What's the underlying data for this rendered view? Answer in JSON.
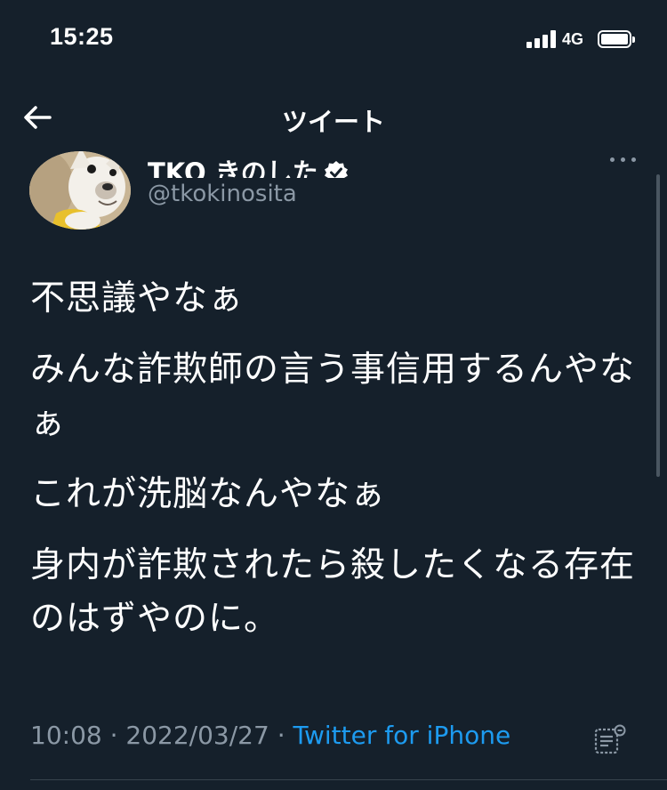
{
  "status_bar": {
    "time": "15:25",
    "network": "4G",
    "signal_bars": 4,
    "battery_level": 1.0
  },
  "nav": {
    "title": "ツイート"
  },
  "author": {
    "display_name": "TKO きのした",
    "handle": "@tkokinosita",
    "verified": true
  },
  "tweet": {
    "lines": [
      "不思議やなぁ",
      "みんな詐欺師の言う事信用するんやなぁ",
      "これが洗脳なんやなぁ",
      "身内が詐欺されたら殺したくなる存在のはずやのに。"
    ]
  },
  "meta": {
    "time": "10:08",
    "separator": "·",
    "date": "2022/03/27",
    "source": "Twitter for iPhone"
  },
  "colors": {
    "background": "#15202b",
    "text": "#ffffff",
    "secondary_text": "#8b98a5",
    "link": "#1d9bf0",
    "divider": "#38444d"
  }
}
